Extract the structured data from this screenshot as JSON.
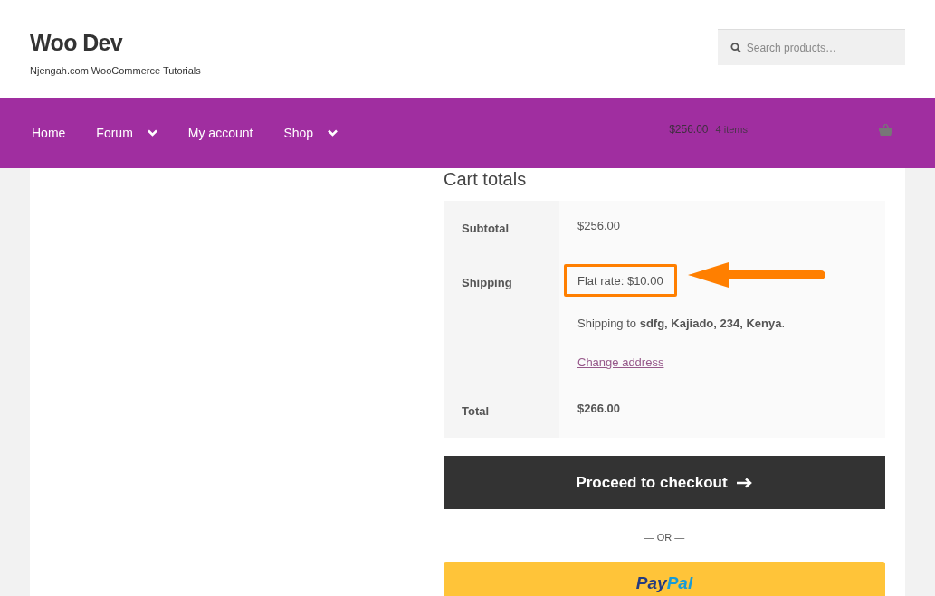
{
  "site": {
    "title": "Woo Dev",
    "tagline": "Njengah.com WooCommerce Tutorials"
  },
  "search": {
    "placeholder": "Search products…"
  },
  "nav": [
    {
      "label": "Home",
      "has_submenu": false
    },
    {
      "label": "Forum",
      "has_submenu": true
    },
    {
      "label": "My account",
      "has_submenu": false
    },
    {
      "label": "Shop",
      "has_submenu": true
    }
  ],
  "cart": {
    "amount": "$256.00",
    "count": "4 items"
  },
  "cart_totals": {
    "heading": "Cart totals",
    "rows": [
      {
        "kind": "plain",
        "label": "Subtotal",
        "value": "$256.00"
      },
      {
        "kind": "shipping",
        "label": "Shipping",
        "value": "Flat rate: $10.00",
        "highlighted": true,
        "note": "Shipping to **sdfg, Kajiado, 234, Kenya**.",
        "link": "Change address"
      },
      {
        "kind": "total",
        "label": "Total",
        "value": "$266.00"
      }
    ]
  },
  "checkout_button": "Proceed to checkout",
  "separator": "— OR —",
  "paypal": {
    "part_1": "Pay",
    "part_2": "Pal"
  }
}
